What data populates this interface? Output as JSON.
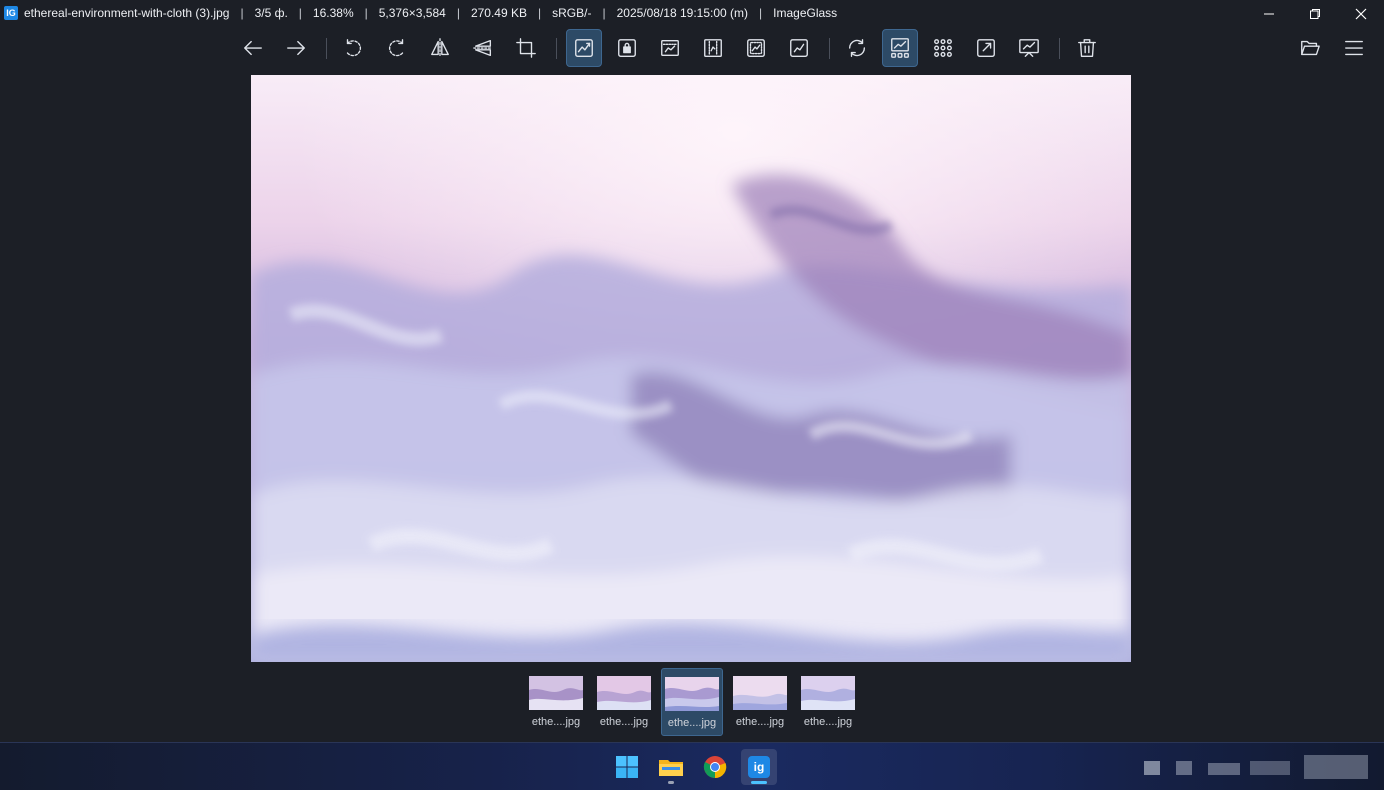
{
  "titlebar": {
    "app_icon_text": "IG",
    "filename": "ethereal-environment-with-cloth (3).jpg",
    "index": "3/5 ф.",
    "zoom": "16.38%",
    "dimensions": "5,376×3,584",
    "filesize": "270.49 KB",
    "color_profile": "sRGB/-",
    "datetime": "2025/08/18 19:15:00 (m)",
    "app_name": "ImageGlass",
    "separator": "|"
  },
  "window_controls": [
    "minimize-icon",
    "restore-icon",
    "close-icon"
  ],
  "toolbar": {
    "buttons": [
      {
        "name": "previous-image",
        "icon": "arrow-left-icon"
      },
      {
        "name": "next-image",
        "icon": "arrow-right-icon"
      },
      {
        "name": "rotate-left",
        "icon": "rotate-left-icon"
      },
      {
        "name": "rotate-right",
        "icon": "rotate-right-icon"
      },
      {
        "name": "flip-horizontal",
        "icon": "flip-horizontal-icon"
      },
      {
        "name": "flip-vertical",
        "icon": "flip-vertical-icon"
      },
      {
        "name": "crop",
        "icon": "crop-icon"
      },
      {
        "name": "auto-zoom",
        "icon": "auto-zoom-icon",
        "active": true
      },
      {
        "name": "lock-zoom",
        "icon": "lock-zoom-icon"
      },
      {
        "name": "scale-to-width",
        "icon": "scale-width-icon"
      },
      {
        "name": "scale-to-height",
        "icon": "scale-height-icon"
      },
      {
        "name": "scale-to-fit",
        "icon": "scale-fit-icon"
      },
      {
        "name": "scale-to-fill",
        "icon": "scale-fill-icon"
      },
      {
        "name": "refresh",
        "icon": "refresh-icon"
      },
      {
        "name": "toggle-gallery",
        "icon": "gallery-icon",
        "active": true
      },
      {
        "name": "thumbnail-grid",
        "icon": "grid-icon"
      },
      {
        "name": "fullscreen",
        "icon": "fullscreen-icon"
      },
      {
        "name": "slideshow",
        "icon": "slideshow-icon"
      },
      {
        "name": "delete",
        "icon": "trash-icon"
      },
      {
        "name": "open-file",
        "icon": "folder-open-icon"
      },
      {
        "name": "main-menu",
        "icon": "menu-icon"
      }
    ]
  },
  "gallery": {
    "thumbnails": [
      {
        "label": "ethe....jpg",
        "active": false
      },
      {
        "label": "ethe....jpg",
        "active": false
      },
      {
        "label": "ethe....jpg",
        "active": true
      },
      {
        "label": "ethe....jpg",
        "active": false
      },
      {
        "label": "ethe....jpg",
        "active": false
      }
    ]
  },
  "taskbar": {
    "apps": [
      {
        "name": "start",
        "icon": "windows-icon"
      },
      {
        "name": "file-explorer",
        "icon": "folder-icon"
      },
      {
        "name": "chrome",
        "icon": "chrome-icon"
      },
      {
        "name": "imageglass",
        "icon": "imageglass-icon",
        "active": true,
        "label": "ig"
      }
    ]
  },
  "colors": {
    "background": "#1c1f26",
    "active_button": "#2d4a66",
    "accent": "#1e88e5"
  }
}
